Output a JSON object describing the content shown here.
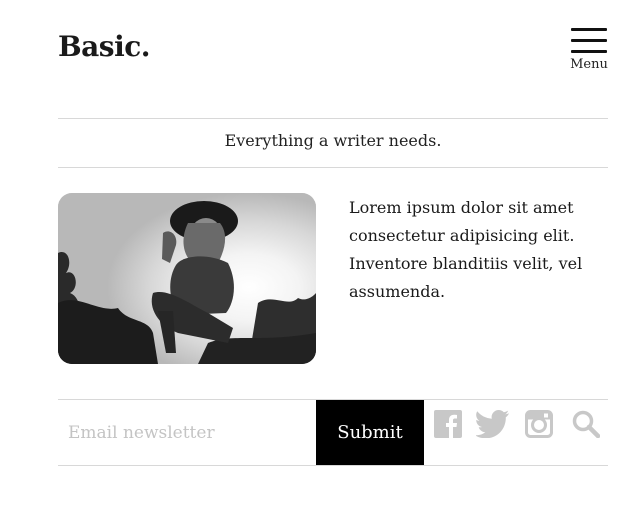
{
  "header": {
    "brand": "Basic.",
    "menu_label": "Menu"
  },
  "tagline": "Everything a writer needs.",
  "article": {
    "image_icon": "photo-woman-hat",
    "body": "Lorem ipsum dolor sit amet consectetur adipisicing elit. Inventore blanditiis velit, vel assumenda."
  },
  "newsletter": {
    "placeholder": "Email newsletter",
    "value": "",
    "submit_label": "Submit"
  },
  "social_icons": [
    "facebook-icon",
    "twitter-icon",
    "instagram-icon",
    "search-icon"
  ],
  "colors": {
    "text": "#1a1a1a",
    "rule": "#d8d8d8",
    "button_bg": "#000000",
    "icon": "#c8c8c8"
  }
}
